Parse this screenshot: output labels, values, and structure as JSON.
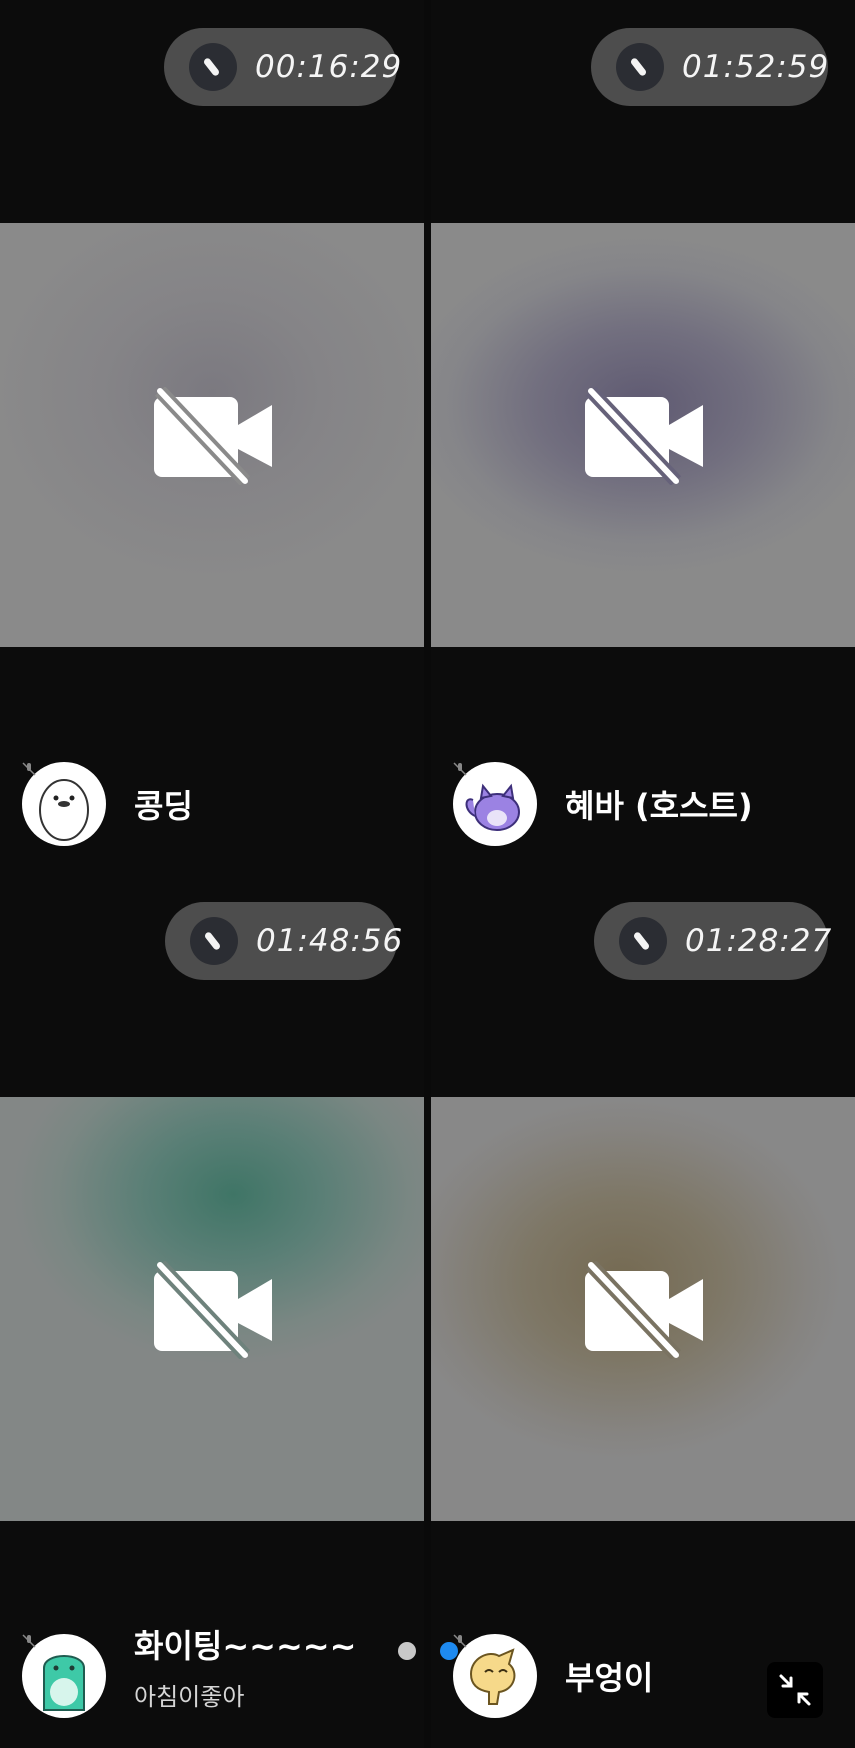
{
  "participants": [
    {
      "name": "콩딩",
      "status": "",
      "duration": "00:16:29",
      "avatar": "white-seal-avatar",
      "tint": "#7b7980"
    },
    {
      "name": "혜바 (호스트)",
      "status": "",
      "duration": "01:52:59",
      "avatar": "purple-cat-avatar",
      "tint": "#5f5a72"
    },
    {
      "name": "화이팅~~~~~",
      "status": "아침이좋아",
      "duration": "01:48:56",
      "avatar": "teal-dino-avatar",
      "tint": "#3f7566"
    },
    {
      "name": "부엉이",
      "status": "",
      "duration": "01:28:27",
      "avatar": "yellow-chick-avatar",
      "tint": "#756a52"
    }
  ],
  "icons": {
    "video_off": "video-off-icon",
    "timer": "timer-icon",
    "mic": "mic-muted-icon",
    "minimize": "minimize-icon"
  },
  "pager": {
    "count": 2,
    "active_index": 1
  },
  "colors": {
    "accent": "#1e8af0",
    "background": "#0a0a0a",
    "pill": "#4d4d4d"
  }
}
